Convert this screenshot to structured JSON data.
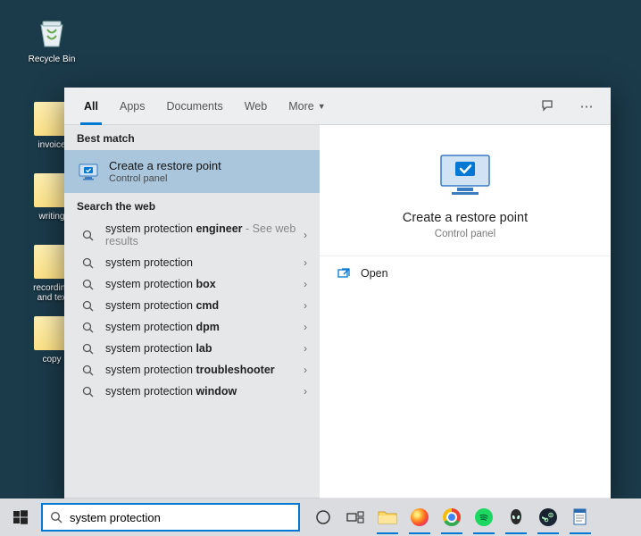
{
  "desktop": {
    "recycle_label": "Recycle Bin",
    "folders": [
      "invoice",
      "writing",
      "recording and tex",
      "copy"
    ]
  },
  "tabs": {
    "all": "All",
    "apps": "Apps",
    "documents": "Documents",
    "web": "Web",
    "more": "More"
  },
  "sections": {
    "best_match": "Best match",
    "search_web": "Search the web"
  },
  "best_match": {
    "title": "Create a restore point",
    "subtitle": "Control panel"
  },
  "web_results": [
    {
      "prefix": "system protection ",
      "bold": "engineer",
      "suffix": " - See web results"
    },
    {
      "prefix": "system protection",
      "bold": "",
      "suffix": ""
    },
    {
      "prefix": "system protection ",
      "bold": "box",
      "suffix": ""
    },
    {
      "prefix": "system protection ",
      "bold": "cmd",
      "suffix": ""
    },
    {
      "prefix": "system protection ",
      "bold": "dpm",
      "suffix": ""
    },
    {
      "prefix": "system protection ",
      "bold": "lab",
      "suffix": ""
    },
    {
      "prefix": "system protection ",
      "bold": "troubleshooter",
      "suffix": ""
    },
    {
      "prefix": "system protection ",
      "bold": "window",
      "suffix": ""
    }
  ],
  "detail": {
    "title": "Create a restore point",
    "subtitle": "Control panel",
    "open": "Open"
  },
  "search_value": "system protection"
}
